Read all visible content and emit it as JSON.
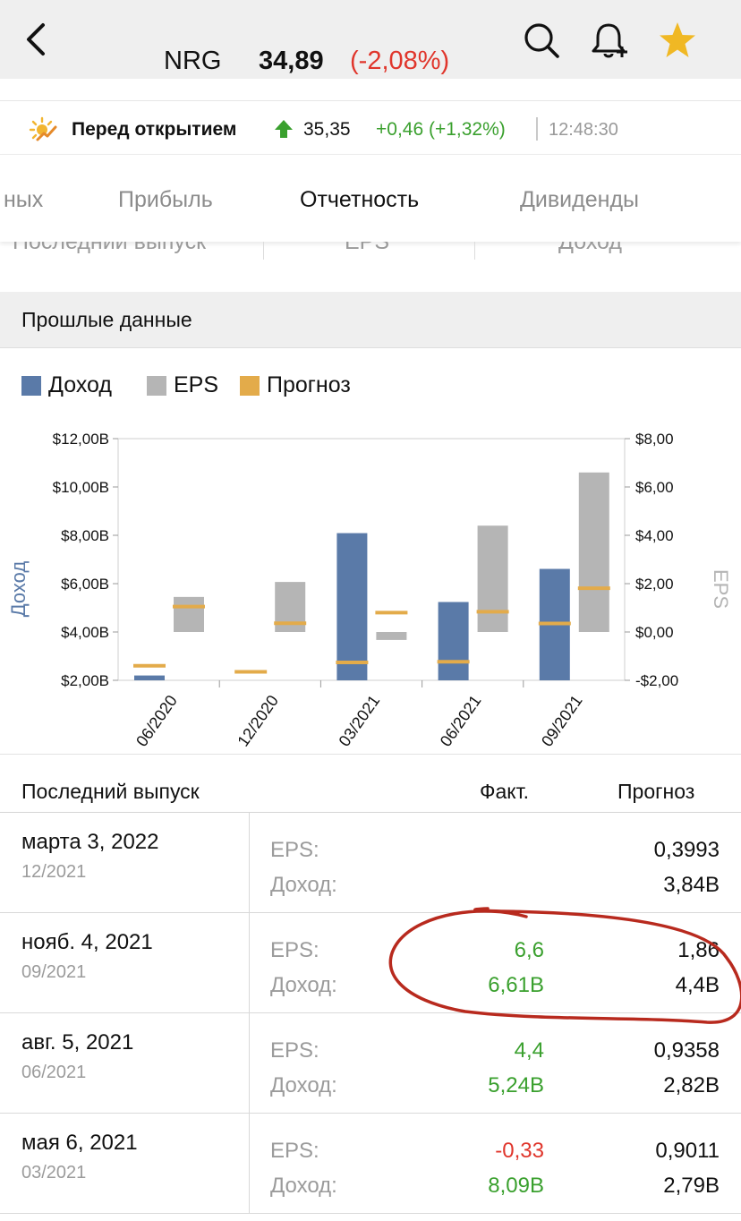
{
  "header": {
    "ticker": "NRG",
    "price": "34,89",
    "change": "(-2,08%)"
  },
  "premarket": {
    "label": "Перед открытием",
    "price": "35,35",
    "change": "+0,46 (+1,32%)",
    "time": "12:48:30"
  },
  "tabs": [
    {
      "label": "ных"
    },
    {
      "label": "Прибыль"
    },
    {
      "label": "Отчетность"
    },
    {
      "label": "Дивиденды"
    }
  ],
  "ghost_header": {
    "col1": "Последний выпуск",
    "col2": "EPS",
    "col3": "Доход"
  },
  "section": {
    "title": "Прошлые данные"
  },
  "legend": [
    {
      "label": "Доход",
      "color": "#5a7aa8"
    },
    {
      "label": "EPS",
      "color": "#b5b5b5"
    },
    {
      "label": "Прогноз",
      "color": "#e3ab4a"
    }
  ],
  "chart_data": {
    "type": "bar",
    "categories": [
      "06/2020",
      "12/2020",
      "03/2021",
      "06/2021",
      "09/2021"
    ],
    "y_left_label": "Доход",
    "y_right_label": "EPS",
    "y_left_ticks": [
      "$2,00B",
      "$4,00B",
      "$6,00B",
      "$8,00B",
      "$10,00B",
      "$12,00B"
    ],
    "y_right_ticks": [
      "-$2,00",
      "$0,00",
      "$2,00",
      "$4,00",
      "$6,00",
      "$8,00"
    ],
    "y_left_range": [
      2,
      12
    ],
    "y_right_range": [
      -2,
      8
    ],
    "series": [
      {
        "name": "Доход",
        "values": [
          2.2,
          null,
          8.09,
          5.24,
          6.61
        ]
      },
      {
        "name": "EPS",
        "values": [
          1.45,
          2.07,
          -0.33,
          4.4,
          6.6
        ]
      },
      {
        "name": "Прогноз",
        "revenue_forecast": [
          2.6,
          2.35,
          2.74,
          2.77,
          4.35
        ],
        "eps_forecast": [
          1.05,
          0.36,
          0.8,
          0.84,
          1.81
        ]
      }
    ],
    "colors": {
      "revenue": "#5a7aa8",
      "eps": "#b5b5b5",
      "forecast": "#e3ab4a"
    }
  },
  "table": {
    "headers": {
      "release": "Последний выпуск",
      "actual": "Факт.",
      "forecast": "Прогноз"
    },
    "rows": [
      {
        "date": "марта 3, 2022",
        "period": "12/2021",
        "eps_label": "EPS:",
        "rev_label": "Доход:",
        "eps_actual": "",
        "rev_actual": "",
        "eps_forecast": "0,3993",
        "rev_forecast": "3,84B"
      },
      {
        "date": "нояб. 4, 2021",
        "period": "09/2021",
        "eps_label": "EPS:",
        "rev_label": "Доход:",
        "eps_actual": "6,6",
        "rev_actual": "6,61B",
        "eps_forecast": "1,86",
        "rev_forecast": "4,4B"
      },
      {
        "date": "авг. 5, 2021",
        "period": "06/2021",
        "eps_label": "EPS:",
        "rev_label": "Доход:",
        "eps_actual": "4,4",
        "rev_actual": "5,24B",
        "eps_forecast": "0,9358",
        "rev_forecast": "2,82B"
      },
      {
        "date": "мая 6, 2021",
        "period": "03/2021",
        "eps_label": "EPS:",
        "rev_label": "Доход:",
        "eps_actual": "-0,33",
        "rev_actual": "8,09B",
        "eps_forecast": "0,9011",
        "rev_forecast": "2,79B"
      }
    ]
  }
}
